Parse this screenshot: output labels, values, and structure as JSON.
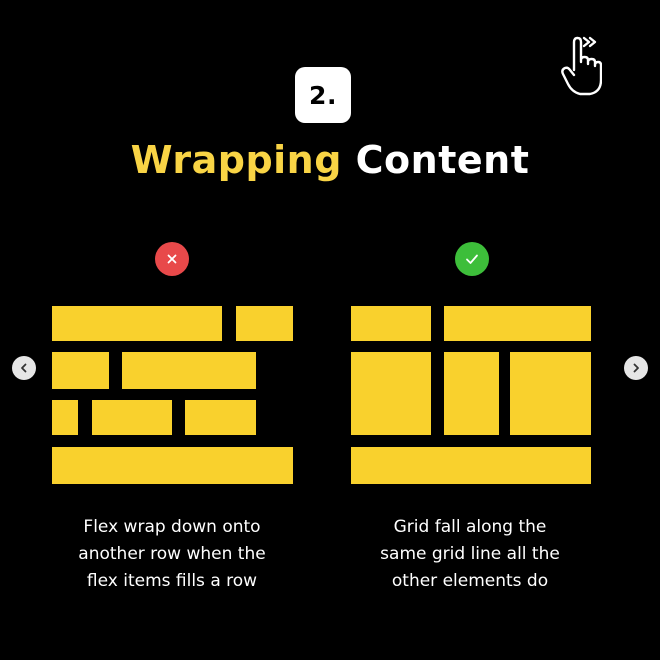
{
  "step": {
    "number_label": "2."
  },
  "title": {
    "accent_text": "Wrapping",
    "plain_text": "Content"
  },
  "icons": {
    "swipe": "swipe-hand-icon",
    "bad": "cross-icon",
    "good": "check-icon",
    "prev": "chevron-left-icon",
    "next": "chevron-right-icon"
  },
  "colors": {
    "background": "#000000",
    "accent_yellow": "#F9D445",
    "block_yellow": "#F9D12D",
    "bad_red": "#E8494A",
    "good_green": "#3DBE3A"
  },
  "left_panel": {
    "caption_lines": [
      "Flex wrap down onto",
      "another row when the",
      "flex items fills a row"
    ]
  },
  "right_panel": {
    "caption_lines": [
      "Grid fall along the",
      "same grid line all the",
      "other elements do"
    ]
  }
}
